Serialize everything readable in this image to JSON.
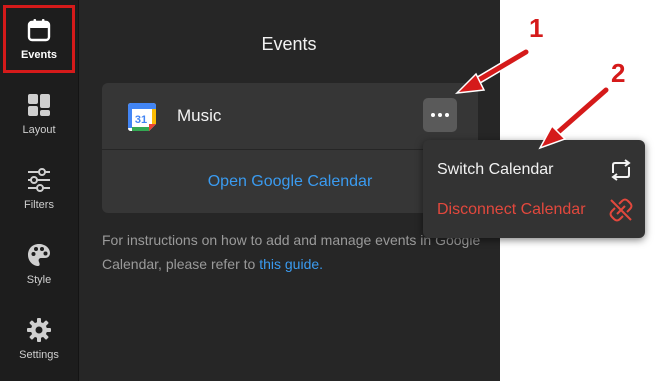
{
  "sidebar": {
    "items": [
      {
        "label": "Events",
        "icon": "calendar-icon",
        "active": true
      },
      {
        "label": "Layout",
        "icon": "layout-icon"
      },
      {
        "label": "Filters",
        "icon": "sliders-icon"
      },
      {
        "label": "Style",
        "icon": "palette-icon"
      },
      {
        "label": "Settings",
        "icon": "gear-icon"
      }
    ]
  },
  "panel": {
    "title": "Events",
    "calendar": {
      "name": "Music",
      "icon": "google-calendar-icon",
      "icon_text": "31"
    },
    "more_icon": "ellipsis-icon",
    "open_link": "Open Google Calendar",
    "help_text": "For instructions on how to add and manage events in Google Calendar, please refer to",
    "help_link": "this guide."
  },
  "menu": {
    "switch_label": "Switch Calendar",
    "switch_icon": "switch-icon",
    "disconnect_label": "Disconnect Calendar",
    "disconnect_icon": "unlink-icon"
  },
  "annotations": {
    "badge_1": "1",
    "badge_2": "2"
  },
  "colors": {
    "accent_blue": "#3a9bf0",
    "danger_red": "#e2483d",
    "annotation_red": "#d51a1a",
    "sidebar_bg": "#1d1d1d",
    "panel_bg": "#262626"
  }
}
